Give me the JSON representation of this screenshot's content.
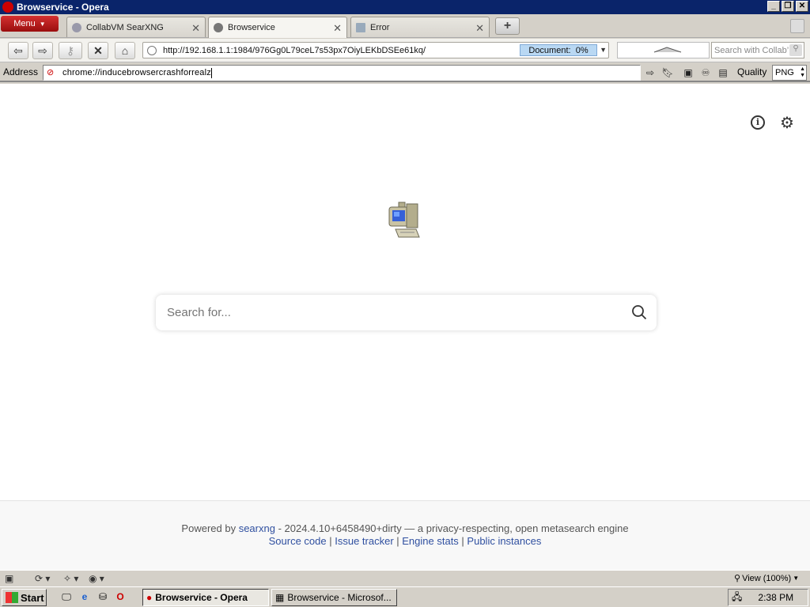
{
  "window": {
    "title": "Browservice - Opera"
  },
  "menu": {
    "label": "Menu"
  },
  "tabs": [
    {
      "label": "CollabVM SearXNG"
    },
    {
      "label": "Browservice"
    },
    {
      "label": "Error"
    }
  ],
  "nav": {
    "url": "http://192.168.1.1:1984/9​76Gg0L79ceL7s53px7OiyLEKbDSEe61kq/",
    "progress_label": "Document:",
    "progress_value": "0%",
    "search_placeholder": "Search with Collab’"
  },
  "addressbar": {
    "label": "Address",
    "value": "chrome://inducebrowsercrashforrealz",
    "quality_label": "Quality",
    "quality_value": "PNG"
  },
  "page": {
    "search_placeholder": "Search for...",
    "footer": {
      "powered_by": "Powered by",
      "searxng_link": "searxng",
      "version_text": " - 2024.4.10+6458490+dirty — a privacy-respecting, open metasearch engine",
      "source_code": "Source code",
      "issue_tracker": "Issue tracker",
      "engine_stats": "Engine stats",
      "public_instances": "Public instances",
      "separator": " | "
    }
  },
  "statusbar": {
    "zoom": "View (100%)"
  },
  "taskbar": {
    "start": "Start",
    "tasks": [
      {
        "label": "Browservice - Opera"
      },
      {
        "label": "Browservice - Microsof..."
      }
    ],
    "clock": "2:38 PM"
  }
}
